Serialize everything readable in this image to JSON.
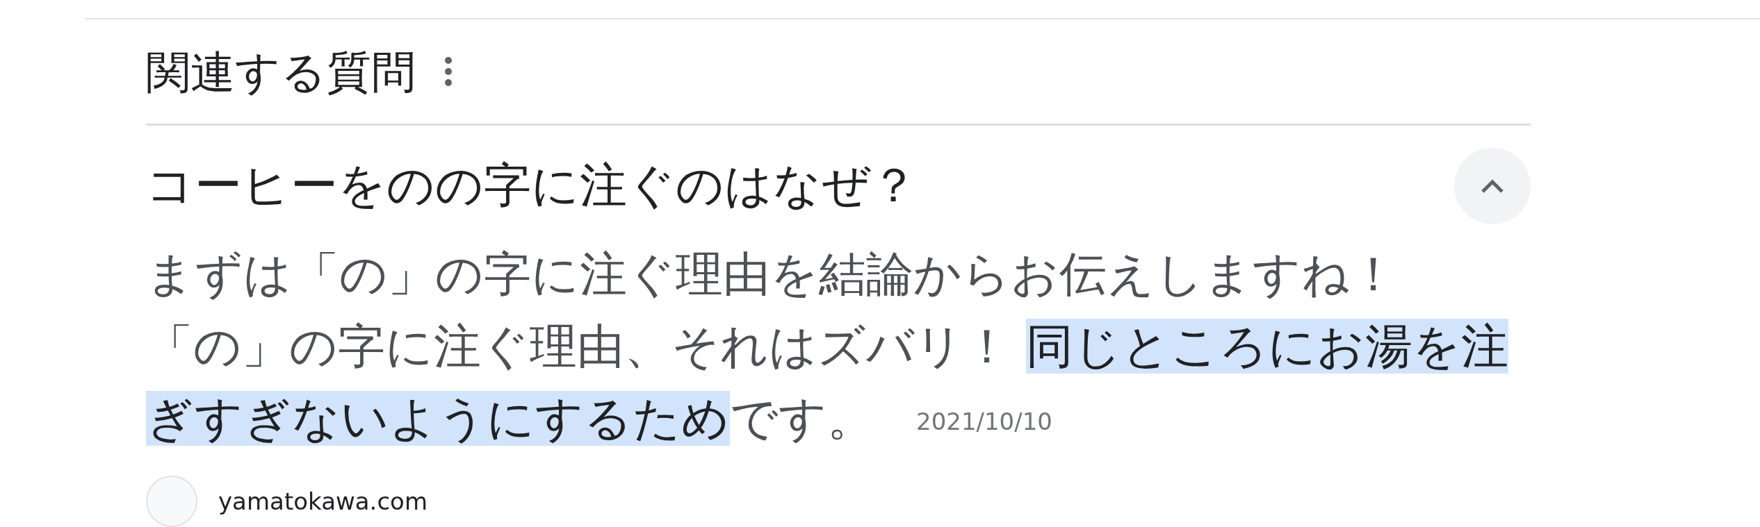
{
  "section": {
    "title": "関連する質問"
  },
  "questions": [
    {
      "text": "コーヒーをのの字に注ぐのはなぜ？",
      "expanded": true,
      "answer": {
        "lines": [
          [
            {
              "text": "まずは「の」の字に注ぐ理由を結論からお伝えしますね！",
              "highlighted": false
            }
          ],
          [
            {
              "text": "「の」の字に注ぐ理由、それはズバリ！ ",
              "highlighted": false
            },
            {
              "text": "同じところにお湯を注ぎすぎないようにするため",
              "highlighted": true
            },
            {
              "text": "です。",
              "highlighted": false
            }
          ]
        ],
        "date": "2021/10/10"
      },
      "source": {
        "site": "yamatokawa.com"
      }
    }
  ]
}
